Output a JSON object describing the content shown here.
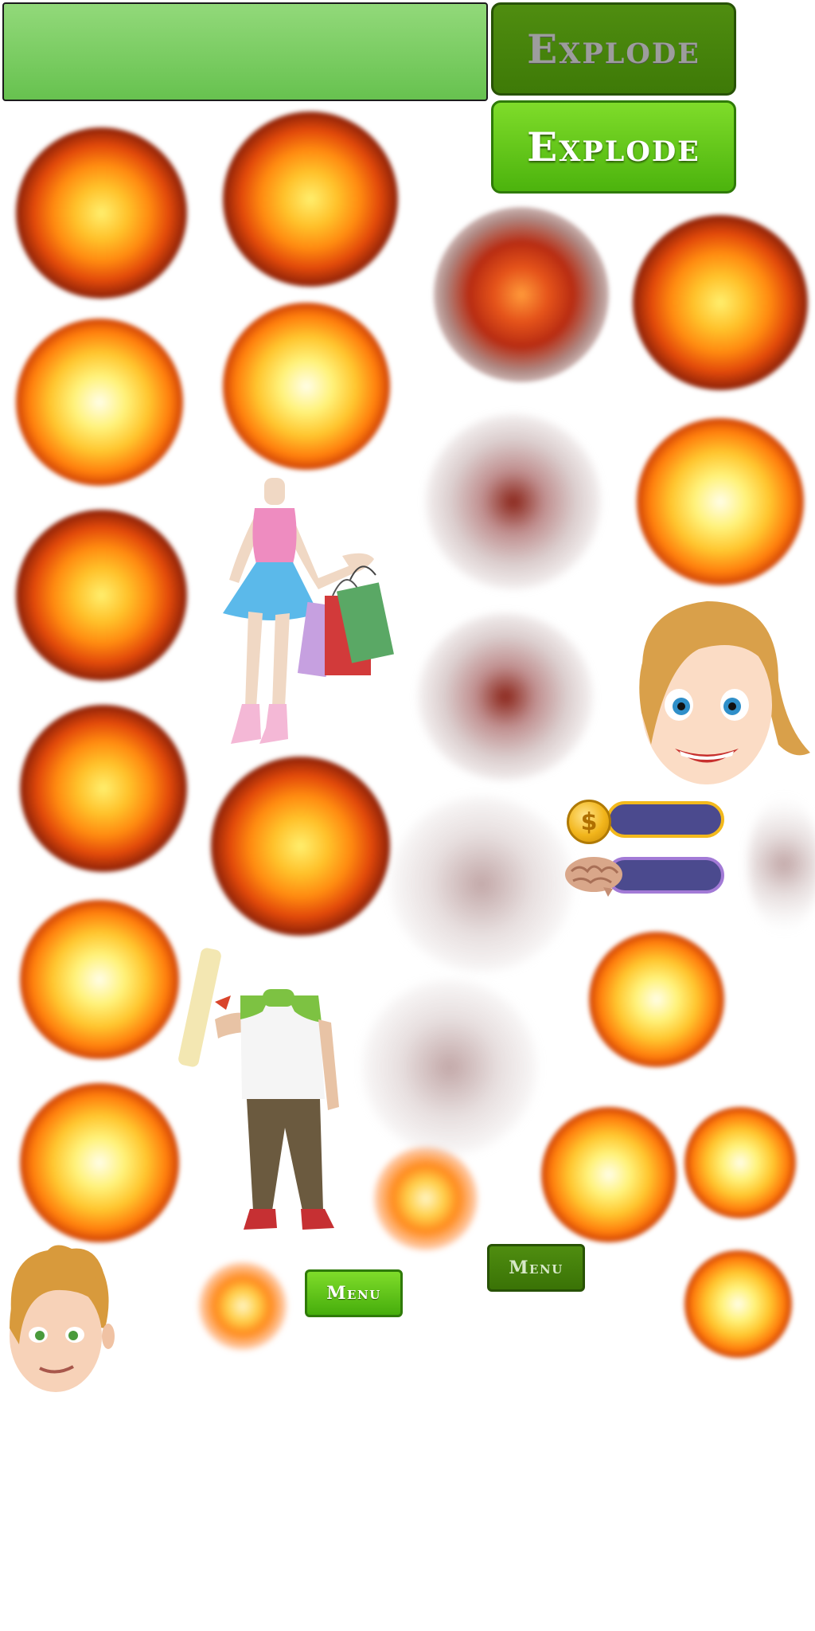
{
  "buttons": {
    "explode_disabled": "Explode",
    "explode_active": "Explode",
    "menu_active": "Menu",
    "menu_disabled": "Menu"
  },
  "hud": {
    "coin_symbol": "$"
  },
  "colors": {
    "button_green": "#5ec41a",
    "button_dark_green": "#3e7a07",
    "bar_fill": "#4b4a8e",
    "bar_gold": "#f3b91c",
    "bar_purple": "#a27ad6"
  }
}
